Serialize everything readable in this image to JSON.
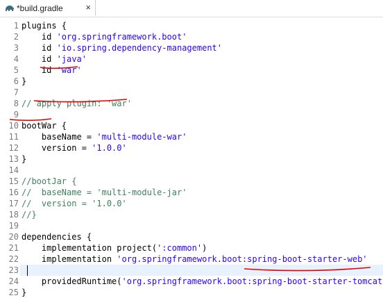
{
  "tab": {
    "title": "*build.gradle",
    "close_label": "×",
    "icon": "gradle-elephant-icon"
  },
  "editor": {
    "line_numbers": [
      "1",
      "2",
      "3",
      "4",
      "5",
      "6",
      "7",
      "8",
      "9",
      "10",
      "11",
      "12",
      "13",
      "14",
      "15",
      "16",
      "17",
      "18",
      "19",
      "20",
      "21",
      "22",
      "23",
      "24",
      "25"
    ],
    "lines": [
      [
        {
          "t": "plugins {",
          "c": "kw"
        }
      ],
      [
        {
          "t": "    id ",
          "c": "kw"
        },
        {
          "t": "'org.springframework.boot'",
          "c": "str"
        }
      ],
      [
        {
          "t": "    id ",
          "c": "kw"
        },
        {
          "t": "'io.spring.dependency-management'",
          "c": "str"
        }
      ],
      [
        {
          "t": "    id ",
          "c": "kw"
        },
        {
          "t": "'java'",
          "c": "str"
        }
      ],
      [
        {
          "t": "    id ",
          "c": "kw"
        },
        {
          "t": "'war'",
          "c": "str"
        }
      ],
      [
        {
          "t": "}",
          "c": "kw"
        }
      ],
      [],
      [
        {
          "t": "// apply plugin: 'war'",
          "c": "cmt"
        }
      ],
      [],
      [
        {
          "t": "bootWar {",
          "c": "kw"
        }
      ],
      [
        {
          "t": "    baseName = ",
          "c": "kw"
        },
        {
          "t": "'multi-module-war'",
          "c": "str"
        }
      ],
      [
        {
          "t": "    version = ",
          "c": "kw"
        },
        {
          "t": "'1.0.0'",
          "c": "str"
        }
      ],
      [
        {
          "t": "}",
          "c": "kw"
        }
      ],
      [],
      [
        {
          "t": "//bootJar {",
          "c": "cmt"
        }
      ],
      [
        {
          "t": "//  baseName = 'multi-module-jar'",
          "c": "cmt"
        }
      ],
      [
        {
          "t": "//  version = '1.0.0'",
          "c": "cmt"
        }
      ],
      [
        {
          "t": "//}",
          "c": "cmt"
        }
      ],
      [],
      [
        {
          "t": "dependencies {",
          "c": "kw"
        }
      ],
      [
        {
          "t": "    implementation project(",
          "c": "kw"
        },
        {
          "t": "':common'",
          "c": "str"
        },
        {
          "t": ")",
          "c": "kw"
        }
      ],
      [
        {
          "t": "    implementation ",
          "c": "kw"
        },
        {
          "t": "'org.springframework.boot:spring-boot-starter-web'",
          "c": "str"
        }
      ],
      [],
      [
        {
          "t": "    providedRuntime(",
          "c": "kw"
        },
        {
          "t": "'org.springframework.boot:spring-boot-starter-tomcat'",
          "c": "str"
        },
        {
          "t": ")",
          "c": "kw"
        }
      ],
      [
        {
          "t": "}",
          "c": "kw"
        }
      ]
    ],
    "colors": {
      "keyword": "#000000",
      "string": "#2a00ff",
      "comment": "#3f7f5f",
      "annotation_underline": "#e00000",
      "current_line": "#e8f2fe"
    }
  }
}
